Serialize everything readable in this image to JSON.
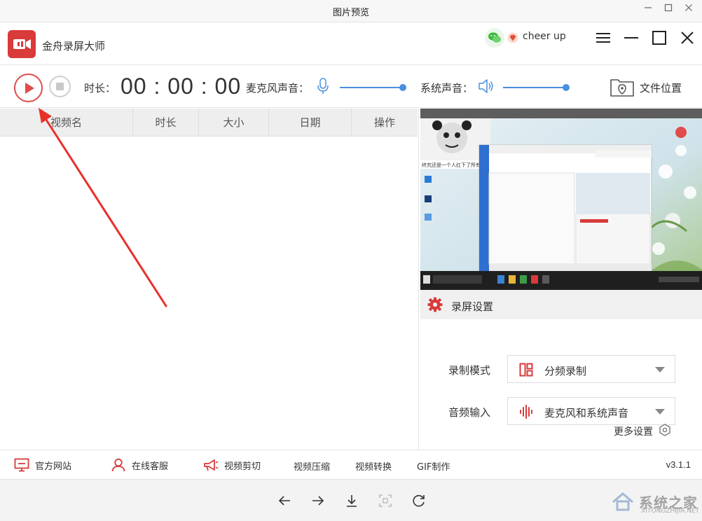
{
  "viewer": {
    "title": "图片预览",
    "watermark_text": "系统之家",
    "watermark_sub": "XITONGZHIJIA.NET"
  },
  "app": {
    "name": "金舟录屏大师",
    "user_name": "cheer up",
    "version": "v3.1.1"
  },
  "toolbar": {
    "duration_label": "时长：",
    "duration_value": "00 : 00 : 00",
    "mic_label": "麦克风声音：",
    "mic_volume": 1.0,
    "system_label": "系统声音：",
    "system_volume": 1.0,
    "folder_label": "文件位置"
  },
  "list": {
    "columns": [
      "视频名",
      "时长",
      "大小",
      "日期",
      "操作"
    ],
    "rows": []
  },
  "settings": {
    "title": "录屏设置",
    "mode_label": "录制模式",
    "mode_value": "分频录制",
    "audio_label": "音频输入",
    "audio_value": "麦克风和系统声音",
    "more_label": "更多设置"
  },
  "footer": {
    "official_site": "官方网站",
    "online_service": "在线客服",
    "video_cut": "视频剪切",
    "video_compress": "视频压缩",
    "video_convert": "视频转换",
    "gif_make": "GIF制作"
  },
  "preview": {
    "caption": "终究还是一个人扛下了所有"
  },
  "colors": {
    "brand_red": "#d93a3a",
    "slider_blue": "#4a8fe0",
    "annotation_red": "#e8302a"
  }
}
